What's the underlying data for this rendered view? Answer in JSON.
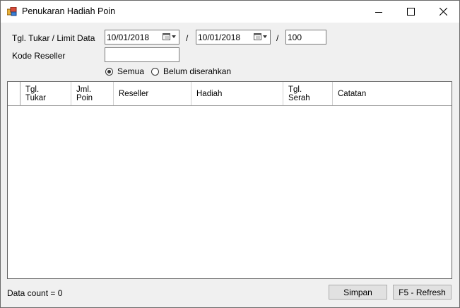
{
  "window": {
    "title": "Penukaran Hadiah Poin",
    "icon": "gift-points-icon"
  },
  "filters": {
    "date_label": "Tgl. Tukar / Limit Data",
    "date_from": "10/01/2018",
    "separator1": "/",
    "date_to": "10/01/2018",
    "separator2": "/",
    "limit": "100",
    "reseller_label": "Kode Reseller",
    "reseller_value": "",
    "radio_all": "Semua",
    "radio_pending": "Belum diserahkan",
    "selected": "Semua"
  },
  "grid": {
    "columns": [
      {
        "line1": "Tgl.",
        "line2": "Tukar"
      },
      {
        "line1": "Jml.",
        "line2": "Poin"
      },
      {
        "line1": "Reseller",
        "line2": ""
      },
      {
        "line1": "Hadiah",
        "line2": ""
      },
      {
        "line1": "Tgl.",
        "line2": "Serah"
      },
      {
        "line1": "Catatan",
        "line2": ""
      }
    ]
  },
  "footer": {
    "data_count": "Data count = 0",
    "save_label": "Simpan",
    "refresh_label": "F5 - Refresh"
  }
}
